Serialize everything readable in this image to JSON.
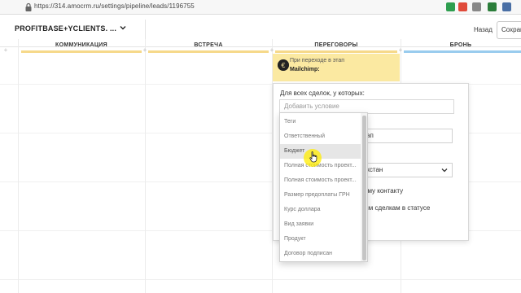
{
  "browser": {
    "url": "https://314.amocrm.ru/settings/pipeline/leads/1196755",
    "ext_colors": [
      "#2e9e4f",
      "#e04a3a",
      "#777777",
      "#2b7d3a",
      "#4a6fa5"
    ]
  },
  "header": {
    "pipeline_name": "PROFITBASE+YCLIENTS. ...",
    "back_label": "Назад",
    "save_label": "Сохрани"
  },
  "columns": [
    {
      "title": "КОММУНИКАЦИЯ",
      "color": "#f6d98a"
    },
    {
      "title": "ВСТРЕЧА",
      "color": "#f6d98a"
    },
    {
      "title": "ПЕРЕГОВОРЫ",
      "color": "#f6d98a"
    },
    {
      "title": "БРОНЬ",
      "color": "#99ccee"
    }
  ],
  "stage_card": {
    "line1": "При переходе в этап",
    "line2": "Mailchimp:"
  },
  "panel": {
    "condition_label": "Для всех сделок, у которых:",
    "condition_placeholder": "Добавить условие",
    "select1_value": "ап",
    "select2_value": "хстан",
    "text1": "ому контакту",
    "text2": "ым сделкам в статусе"
  },
  "dropdown": {
    "options": [
      "Теги",
      "Ответственный",
      "Бюджет",
      "Полная стоимость проект...",
      "Полная стоимость проект...",
      "Размер предоплаты ГРН",
      "Курс доллара",
      "Вид заявки",
      "Продукт",
      "Договор подписан"
    ],
    "hovered_index": 2
  }
}
